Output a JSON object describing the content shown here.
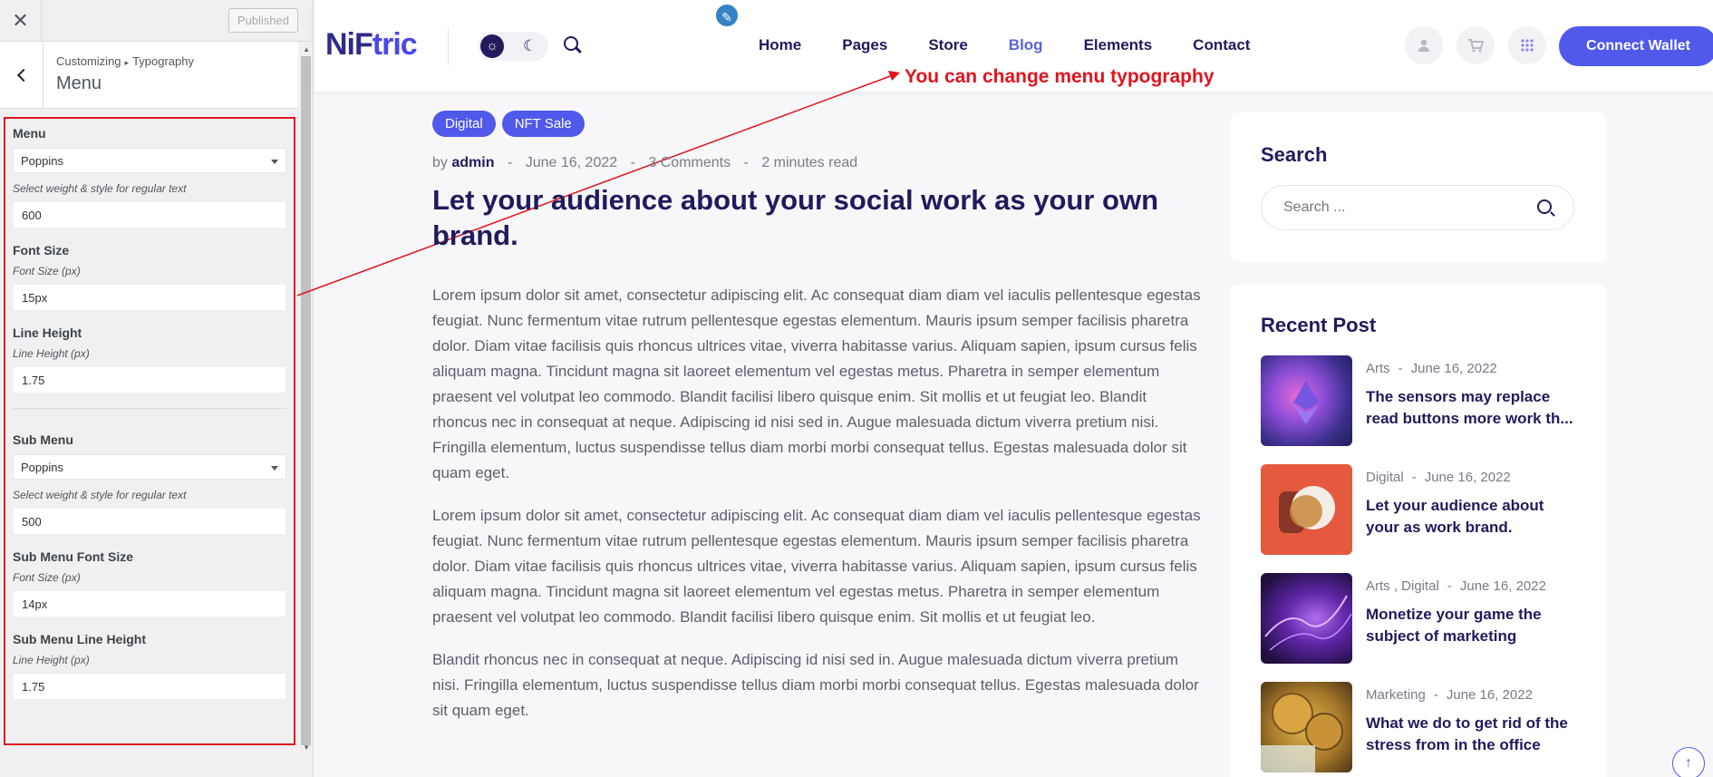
{
  "customizer": {
    "close_label": "✕",
    "published_label": "Published",
    "breadcrumb": [
      "Customizing",
      "Typography"
    ],
    "breadcrumb_separator": "▸",
    "section_title": "Menu",
    "menu": {
      "title": "Menu",
      "font_family": "Poppins",
      "weight_hint": "Select weight & style for regular text",
      "weight": "600",
      "font_size_title": "Font Size",
      "font_size_hint": "Font Size (px)",
      "font_size": "15px",
      "line_height_title": "Line Height",
      "line_height_hint": "Line Height (px)",
      "line_height": "1.75"
    },
    "submenu": {
      "title": "Sub Menu",
      "font_family": "Poppins",
      "weight_hint": "Select weight & style for regular text",
      "weight": "500",
      "font_size_title": "Sub Menu Font Size",
      "font_size_hint": "Font Size (px)",
      "font_size": "14px",
      "line_height_title": "Sub Menu Line Height",
      "line_height_hint": "Line Height (px)",
      "line_height": "1.75"
    }
  },
  "header": {
    "logo_part1": "NiF",
    "logo_part2": "tric",
    "nav": [
      "Home",
      "Pages",
      "Store",
      "Blog",
      "Elements",
      "Contact"
    ],
    "active_nav": "Blog",
    "connect_label": "Connect Wallet"
  },
  "annotation": "You can change menu typography",
  "article": {
    "tags": [
      "Digital",
      "NFT Sale"
    ],
    "meta": {
      "by": "by",
      "author": "admin",
      "date": "June 16, 2022",
      "comments": "3 Comments",
      "read_time": "2 minutes read"
    },
    "title": "Let your audience about your social work as your own brand.",
    "paragraphs": [
      "Lorem ipsum dolor sit amet, consectetur adipiscing elit. Ac consequat diam diam vel iaculis pellentesque egestas feugiat. Nunc fermentum vitae rutrum pellentesque egestas elementum. Mauris ipsum semper facilisis pharetra dolor. Diam vitae facilisis quis rhoncus ultrices vitae, viverra habitasse varius. Aliquam sapien, ipsum cursus felis aliquam magna. Tincidunt magna sit laoreet elementum vel egestas metus. Pharetra in semper elementum praesent vel volutpat leo commodo. Blandit facilisi libero quisque enim. Sit mollis et ut feugiat leo. Blandit rhoncus nec in consequat at neque. Adipiscing id nisi sed in. Augue malesuada dictum viverra pretium nisi. Fringilla elementum, luctus suspendisse tellus diam morbi morbi consequat tellus. Egestas malesuada dolor sit quam eget.",
      "Lorem ipsum dolor sit amet, consectetur adipiscing elit. Ac consequat diam diam vel iaculis pellentesque egestas feugiat. Nunc fermentum vitae rutrum pellentesque egestas elementum. Mauris ipsum semper facilisis pharetra dolor. Diam vitae facilisis quis rhoncus ultrices vitae, viverra habitasse varius. Aliquam sapien, ipsum cursus felis aliquam magna. Tincidunt magna sit laoreet elementum vel egestas metus. Pharetra in semper elementum praesent vel volutpat leo commodo. Blandit facilisi libero quisque enim. Sit mollis et ut feugiat leo.",
      "Blandit rhoncus nec in consequat at neque. Adipiscing id nisi sed in. Augue malesuada dictum viverra pretium nisi. Fringilla elementum, luctus suspendisse tellus diam morbi morbi consequat tellus. Egestas malesuada dolor sit quam eget."
    ]
  },
  "sidebar": {
    "search_title": "Search",
    "search_placeholder": "Search ...",
    "recent_title": "Recent Post",
    "posts": [
      {
        "category": "Arts",
        "date": "June 16, 2022",
        "title": "The sensors may replace read buttons more work th..."
      },
      {
        "category": "Digital",
        "date": "June 16, 2022",
        "title": "Let your audience about your as work brand."
      },
      {
        "category": "Arts , Digital",
        "date": "June 16, 2022",
        "title": "Monetize your game the subject of marketing"
      },
      {
        "category": "Marketing",
        "date": "June 16, 2022",
        "title": "What we do to get rid of the stress from in the office"
      }
    ]
  },
  "icons": {
    "close": "close-icon",
    "back": "chevron-left-icon",
    "edit": "pencil-icon",
    "sun": "sun-icon",
    "moon": "moon-icon",
    "search": "search-icon",
    "user": "user-icon",
    "cart": "cart-icon",
    "apps": "grid-icon",
    "to_top": "arrow-up-icon"
  },
  "colors": {
    "accent": "#5059ea",
    "heading": "#1f1b5c",
    "annotation": "#e0141f"
  }
}
